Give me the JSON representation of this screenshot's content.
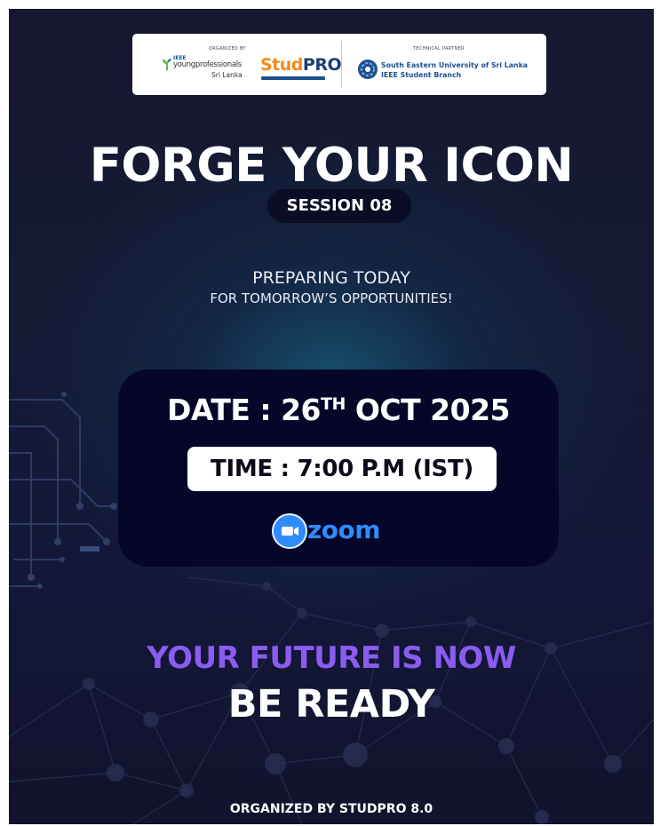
{
  "logo_bar": {
    "organized_by_label": "ORGANIZED BY",
    "ieee_label": "IEEE",
    "yp_label": "youngprofessionals",
    "yp_region": "Sri Lanka",
    "studpro_stud": "Stud",
    "studpro_pro": "PRO",
    "technical_partner_label": "TECHNICAL PARTNER",
    "partner_line1": "South Eastern University of Sri Lanka",
    "partner_line2": "IEEE Student Branch"
  },
  "title": "FORGE YOUR ICON",
  "session": "SESSION 08",
  "tagline": {
    "line1": "PREPARING TODAY",
    "line2": "FOR TOMORROW’S OPPORTUNITIES!"
  },
  "event": {
    "date_prefix": "DATE : 26",
    "date_suffix_sup": "TH",
    "date_rest": " OCT 2025",
    "time": "TIME : 7:00 P.M (IST)",
    "platform": "zoom"
  },
  "slogan": {
    "line1": "YOUR FUTURE IS NOW",
    "line2": "BE READY"
  },
  "footer": "ORGANIZED BY STUDPRO 8.0",
  "colors": {
    "background": "#15182e",
    "accent_purple": "#8a5cf0",
    "zoom_blue": "#2d8cff",
    "studpro_orange": "#f18a1c",
    "box_navy": "#06062a"
  }
}
